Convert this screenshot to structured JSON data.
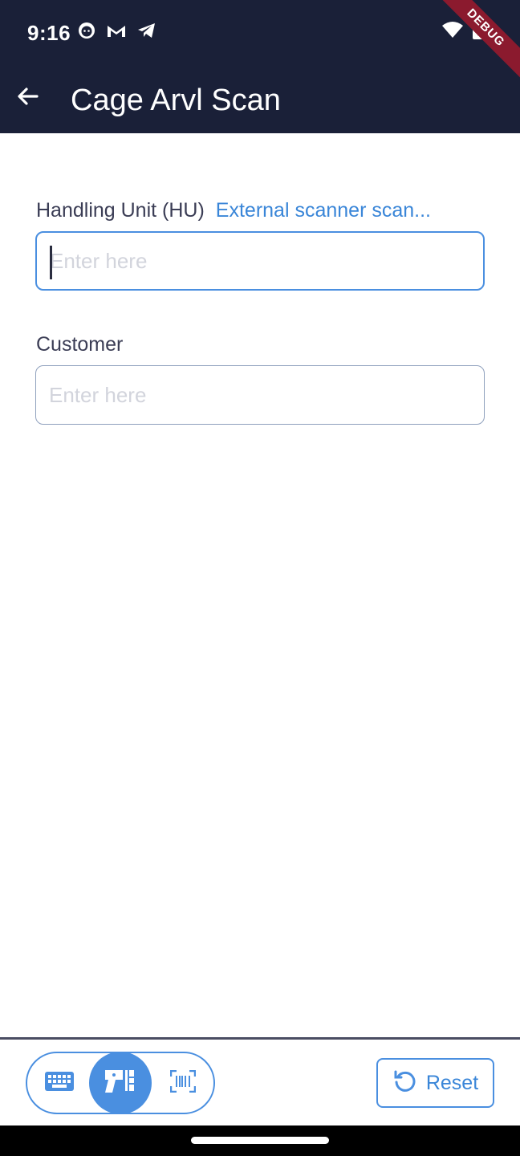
{
  "status_bar": {
    "time": "9:16",
    "left_icons": [
      "face-notification-icon",
      "gmail-icon",
      "telegram-icon"
    ],
    "right_icons": [
      "wifi-icon",
      "battery-charging-icon"
    ],
    "debug_label": "DEBUG"
  },
  "app_bar": {
    "title": "Cage Arvl Scan",
    "back_icon": "arrow-back-icon"
  },
  "form": {
    "handling_unit": {
      "label": "Handling Unit (HU)",
      "link": "External scanner scan...",
      "placeholder": "Enter here",
      "value": ""
    },
    "customer": {
      "label": "Customer",
      "placeholder": "Enter here",
      "value": ""
    }
  },
  "bottom_bar": {
    "modes": [
      {
        "name": "keyboard-icon",
        "active": false
      },
      {
        "name": "handheld-scanner-icon",
        "active": true
      },
      {
        "name": "barcode-scan-icon",
        "active": false
      }
    ],
    "reset_label": "Reset"
  },
  "colors": {
    "app_bar_bg": "#1a2038",
    "accent": "#4a8fe0",
    "debug_ribbon": "#8b1a2e"
  }
}
